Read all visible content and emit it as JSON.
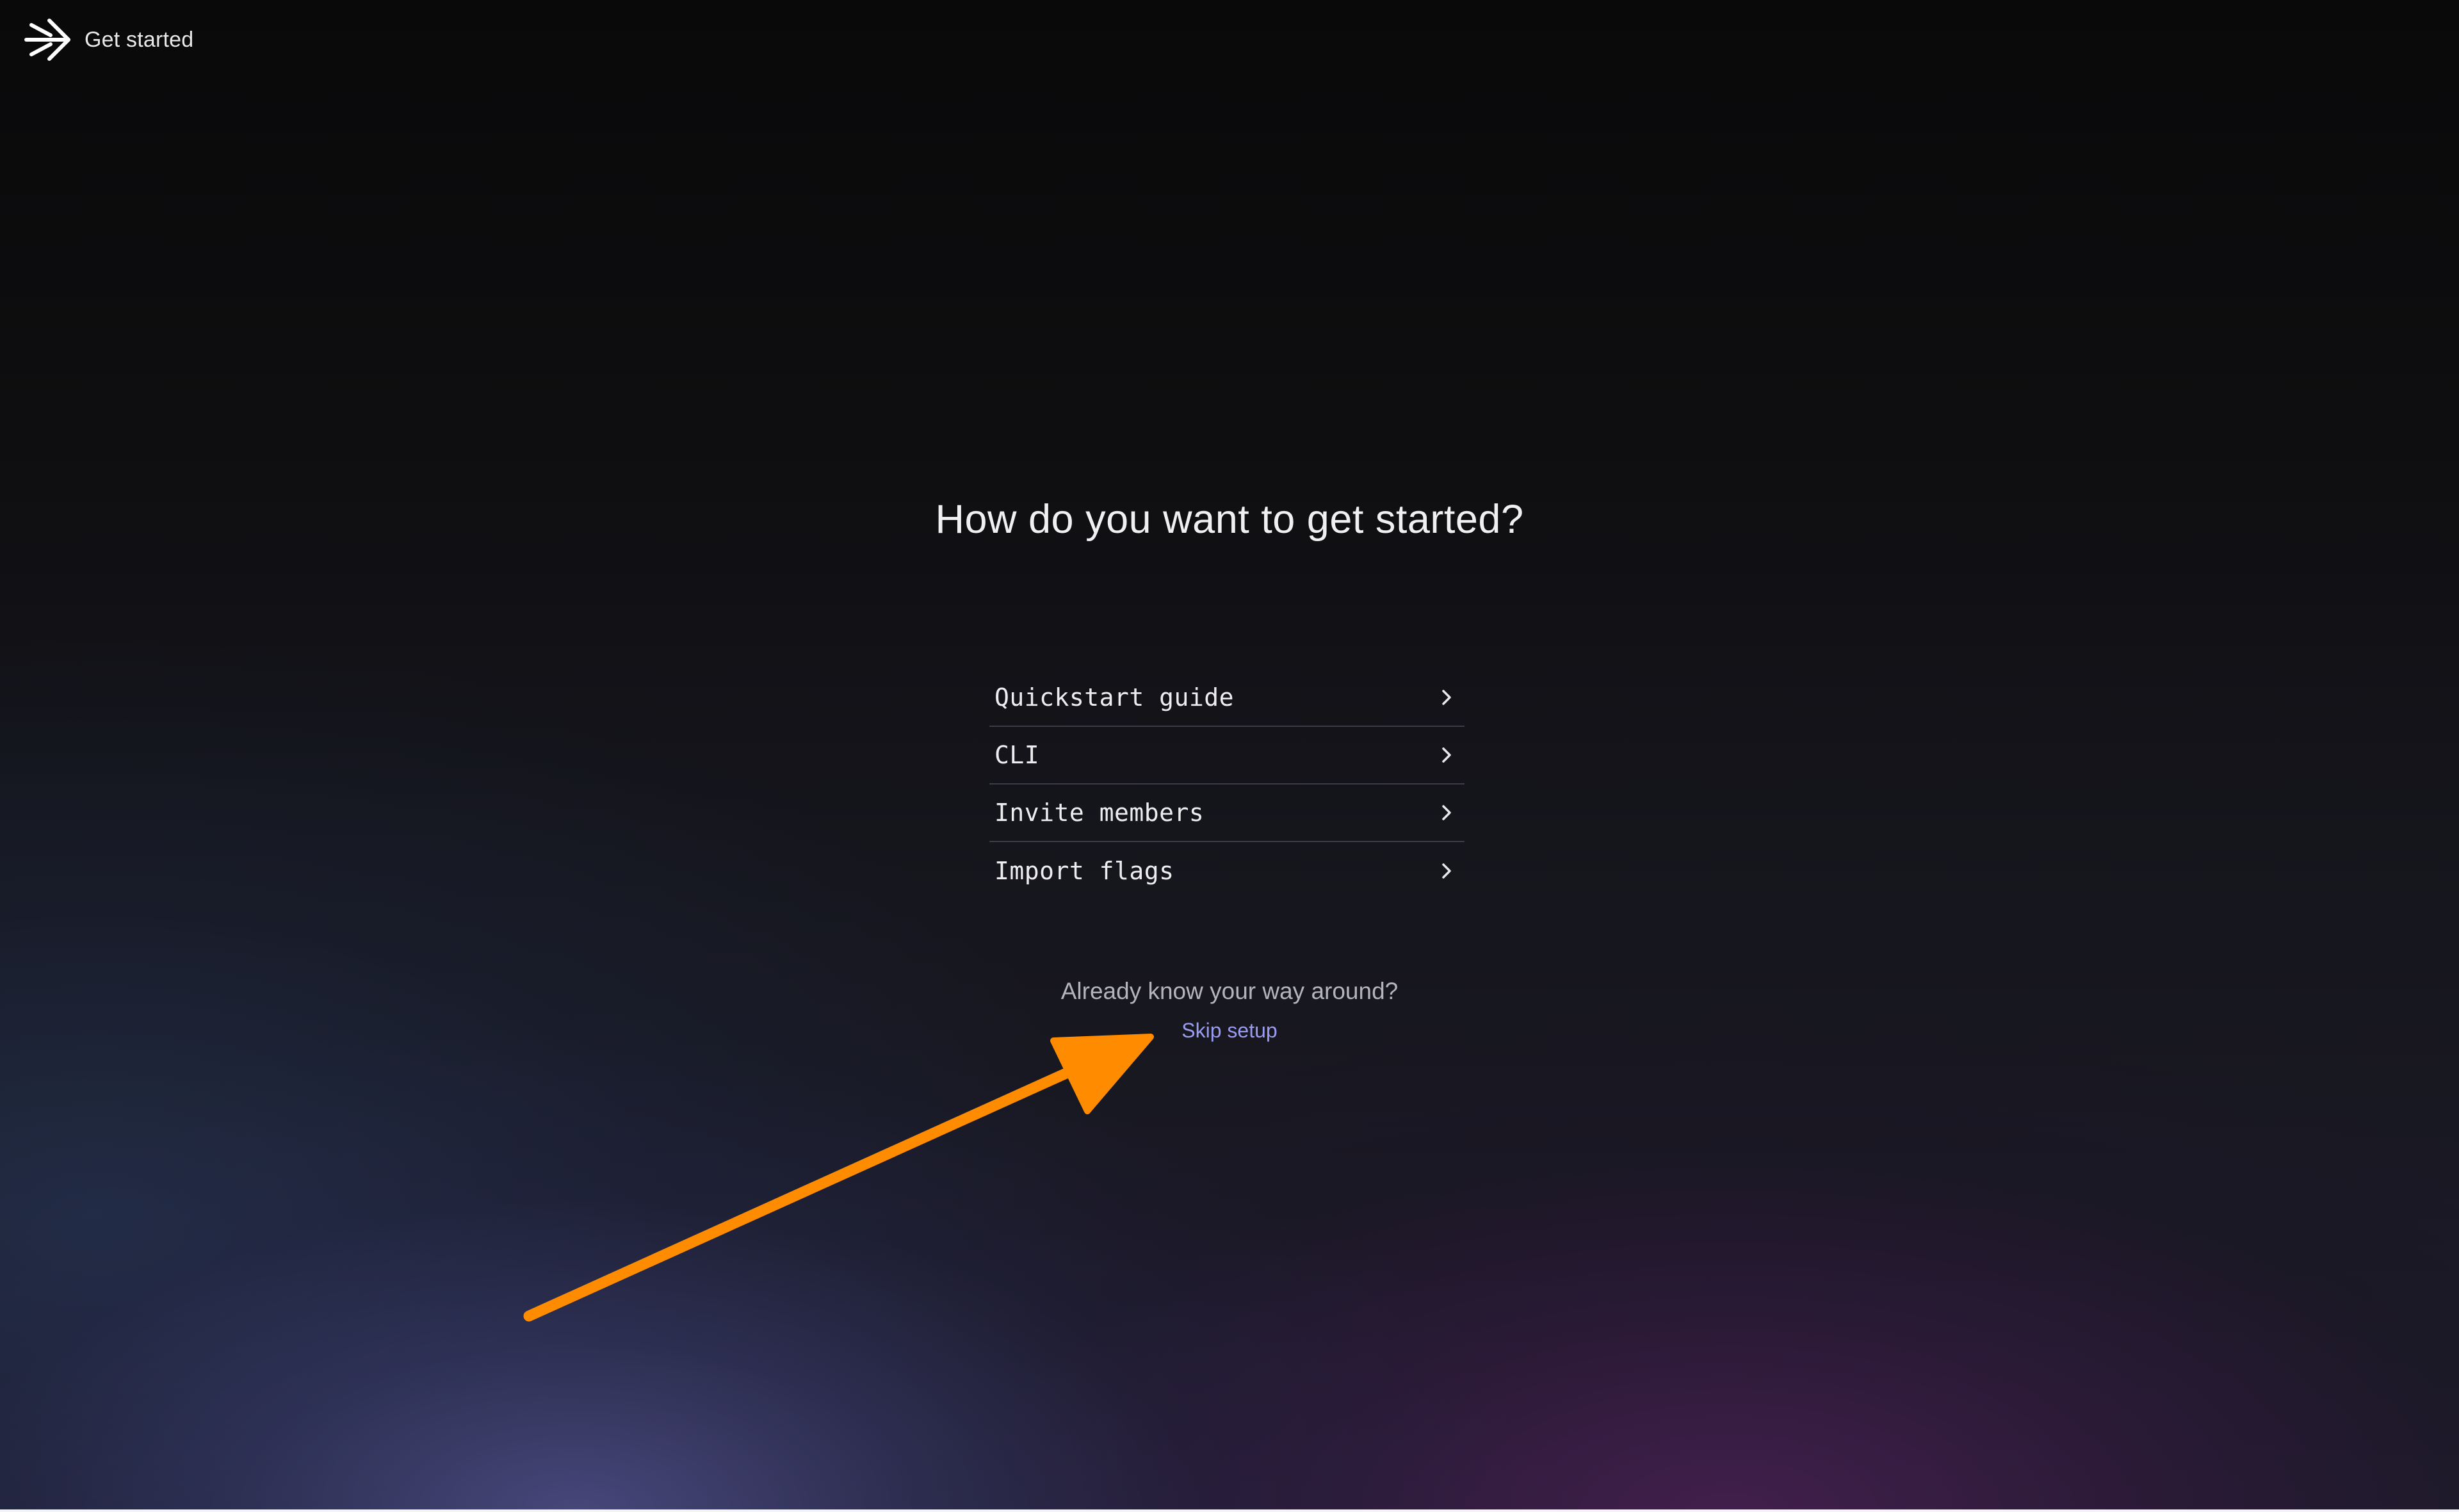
{
  "header": {
    "logo_icon": "arrow-right-logo-icon",
    "title": "Get started"
  },
  "main": {
    "heading": "How do you want to get started?",
    "options": [
      {
        "label": "Quickstart guide",
        "icon": "chevron-right-icon"
      },
      {
        "label": "CLI",
        "icon": "chevron-right-icon"
      },
      {
        "label": "Invite members",
        "icon": "chevron-right-icon"
      },
      {
        "label": "Import flags",
        "icon": "chevron-right-icon"
      }
    ],
    "footer_text": "Already know your way around?",
    "skip_label": "Skip setup"
  },
  "annotation": {
    "icon": "pointer-arrow-icon",
    "color": "#ff8c00"
  },
  "colors": {
    "link": "#9a9cf2",
    "divider": "#3c3c44"
  }
}
